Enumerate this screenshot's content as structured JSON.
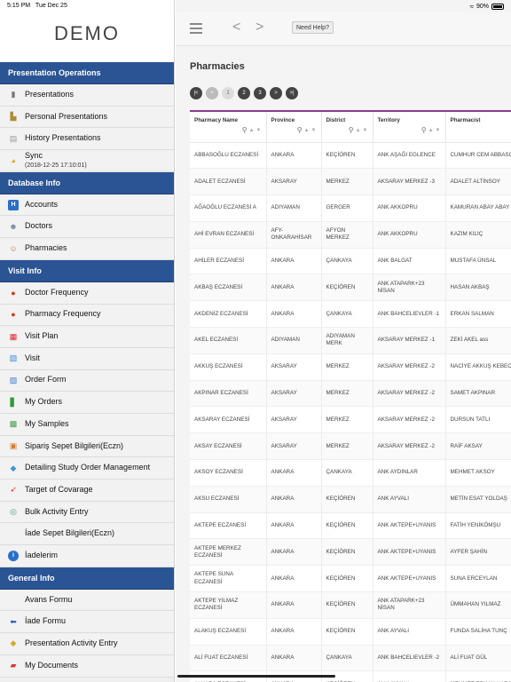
{
  "status": {
    "time": "5:15 PM",
    "date": "Tue Dec 25",
    "battery": "90%"
  },
  "logo": "DEMO",
  "sidebar": {
    "sections": [
      {
        "title": "Presentation Operations",
        "items": [
          {
            "label": "Presentations",
            "icon": "presentation-icon",
            "color": "#777"
          },
          {
            "label": "Personal Presentations",
            "icon": "personal-presentation-icon",
            "color": "#b08d3a"
          },
          {
            "label": "History Presentations",
            "icon": "history-icon",
            "color": "#999"
          },
          {
            "label": "Sync",
            "sub": "(2018-12-25 17:10:01)",
            "icon": "sync-icon",
            "color": "#e6a21a"
          }
        ]
      },
      {
        "title": "Database Info",
        "items": [
          {
            "label": "Accounts",
            "icon": "accounts-icon",
            "color": "#2a6fc9"
          },
          {
            "label": "Doctors",
            "icon": "doctors-icon",
            "color": "#7a8aa0"
          },
          {
            "label": "Pharmacies",
            "icon": "pharmacies-icon",
            "color": "#b07a4a"
          }
        ]
      },
      {
        "title": "Visit Info",
        "items": [
          {
            "label": "Doctor Frequency",
            "icon": "pie-chart-icon",
            "color": "#d9381e"
          },
          {
            "label": "Pharmacy Frequency",
            "icon": "pie-chart-icon",
            "color": "#d9381e"
          },
          {
            "label": "Visit Plan",
            "icon": "calendar-icon",
            "color": "#d23"
          },
          {
            "label": "Visit",
            "icon": "visit-icon",
            "color": "#3a8ad6"
          },
          {
            "label": "Order Form",
            "icon": "order-form-icon",
            "color": "#3a7ac9"
          },
          {
            "label": "My Orders",
            "icon": "my-orders-icon",
            "color": "#2e9b3a"
          },
          {
            "label": "My Samples",
            "icon": "samples-icon",
            "color": "#4a9a4a"
          },
          {
            "label": "Sipariş Sepet Bilgileri(Eczn)",
            "icon": "basket-icon",
            "color": "#d87a2a"
          },
          {
            "label": "Detailing Study Order Management",
            "icon": "detailing-icon",
            "color": "#3a9ad6"
          },
          {
            "label": "Target of Covarage",
            "icon": "target-icon",
            "color": "#d9381e"
          },
          {
            "label": "Bulk Activity Entry",
            "icon": "bulk-activity-icon",
            "color": "#4aa06a"
          },
          {
            "label": "İade Sepet Bilgileri(Eczn)",
            "icon": "",
            "color": "#fff"
          },
          {
            "label": "İadelerim",
            "icon": "info-icon",
            "color": "#2a6fc9"
          }
        ]
      },
      {
        "title": "General Info",
        "items": [
          {
            "label": "Avans Formu",
            "icon": "",
            "color": "#fff"
          },
          {
            "label": "İade Formu",
            "icon": "back-arrow-icon",
            "color": "#2a5abf"
          },
          {
            "label": "Presentation Activity Entry",
            "icon": "activity-entry-icon",
            "color": "#d8a62a"
          },
          {
            "label": "My Documents",
            "icon": "pdf-icon",
            "color": "#d33"
          }
        ]
      }
    ]
  },
  "toolbar": {
    "help_label": "Need Help?",
    "back": "<",
    "forward": ">"
  },
  "page": {
    "title": "Pharmacies"
  },
  "pager": [
    "|<",
    "<",
    "1",
    "2",
    "3",
    ">",
    ">|"
  ],
  "table": {
    "columns": [
      "Pharmacy Name",
      "Province",
      "District",
      "Territory",
      "Pharmacist"
    ],
    "rows": [
      [
        "ABBASOĞLU ECZANESİ",
        "ANKARA",
        "KEÇİÖREN",
        "ANK AŞAĞI EGLENCE",
        "CUMHUR CEM ABBASOĞLU"
      ],
      [
        "ADALET ECZANESİ",
        "AKSARAY",
        "MERKEZ",
        "AKSARAY MERKEZ -3",
        "ADALET ALTINSOY"
      ],
      [
        "AĞAOĞLU ECZANESİ A",
        "ADIYAMAN",
        "GERGER",
        "ANK AKKOPRU",
        "KAMURAN ABAY ABAY"
      ],
      [
        "AHİ EVRAN ECZANESİ",
        "AFY-ONKARAHİSAR",
        "AFYON MERKEZ",
        "ANK AKKOPRU",
        "KAZIM KILIÇ"
      ],
      [
        "AHİLER ECZANESİ",
        "ANKARA",
        "ÇANKAYA",
        "ANK BALGAT",
        "MUSTAFA ÜNSAL"
      ],
      [
        "AKBAŞ ECZANESİ",
        "ANKARA",
        "KEÇİÖREN",
        "ANK ATAPARK+23 NİSAN",
        "HASAN AKBAŞ"
      ],
      [
        "AKDENİZ ECZANESİ",
        "ANKARA",
        "ÇANKAYA",
        "ANK BAHCELIEVLER -1",
        "ERKAN SALMAN"
      ],
      [
        "AKEL ECZANESİ",
        "ADIYAMAN",
        "ADIYAMAN MERK",
        "AKSARAY MERKEZ -1",
        "ZEKİ AKEL ass"
      ],
      [
        "AKKUŞ ECZANESİ",
        "AKSARAY",
        "MERKEZ",
        "AKSARAY MERKEZ -2",
        "NACİYE AKKUŞ KEBECİ"
      ],
      [
        "AKPINAR ECZANESİ",
        "AKSARAY",
        "MERKEZ",
        "AKSARAY MERKEZ -2",
        "SAMET AKPINAR"
      ],
      [
        "AKSARAY ECZANESİ",
        "AKSARAY",
        "MERKEZ",
        "AKSARAY MERKEZ -2",
        "DURSUN TATLI"
      ],
      [
        "AKSAY ECZANESİ",
        "AKSARAY",
        "MERKEZ",
        "AKSARAY MERKEZ -2",
        "RAİF AKSAY"
      ],
      [
        "AKSOY ECZANESİ",
        "ANKARA",
        "ÇANKAYA",
        "ANK AYDINLAR",
        "MEHMET AKSOY"
      ],
      [
        "AKSU ECZANESİ",
        "ANKARA",
        "KEÇİÖREN",
        "ANK AYVALI",
        "METİN ESAT YOLDAŞ"
      ],
      [
        "AKTEPE ECZANESİ",
        "ANKARA",
        "KEÇİÖREN",
        "ANK AKTEPE+UYANIS",
        "FATİH YENİKÖMŞU"
      ],
      [
        "AKTEPE MERKEZ ECZANESİ",
        "ANKARA",
        "KEÇİÖREN",
        "ANK AKTEPE+UYANIS",
        "AYFER ŞAHİN"
      ],
      [
        "AKTEPE SUNA ECZANESİ",
        "ANKARA",
        "KEÇİÖREN",
        "ANK AKTEPE+UYANIS",
        "SUNA ERCEYLAN"
      ],
      [
        "AKTEPE YILMAZ ECZANESİ",
        "ANKARA",
        "KEÇİÖREN",
        "ANK ATAPARK+23 NİSAN",
        "ÜMMAHAN YILMAZ"
      ],
      [
        "ALAKUŞ ECZANESİ",
        "ANKARA",
        "KEÇİÖREN",
        "ANK AYVALI",
        "FUNDA SALİHA TUNÇ"
      ],
      [
        "ALİ FUAT ECZANESİ",
        "ANKARA",
        "ÇANKAYA",
        "ANK BAHCELIEVLER -2",
        "ALİ FUAT GÜL"
      ],
      [
        "ALKARA ECZANESİ",
        "ANKARA",
        "KEÇİÖREN",
        "ANK AYVALI",
        "MEHMET ERKAN KARA"
      ]
    ]
  }
}
